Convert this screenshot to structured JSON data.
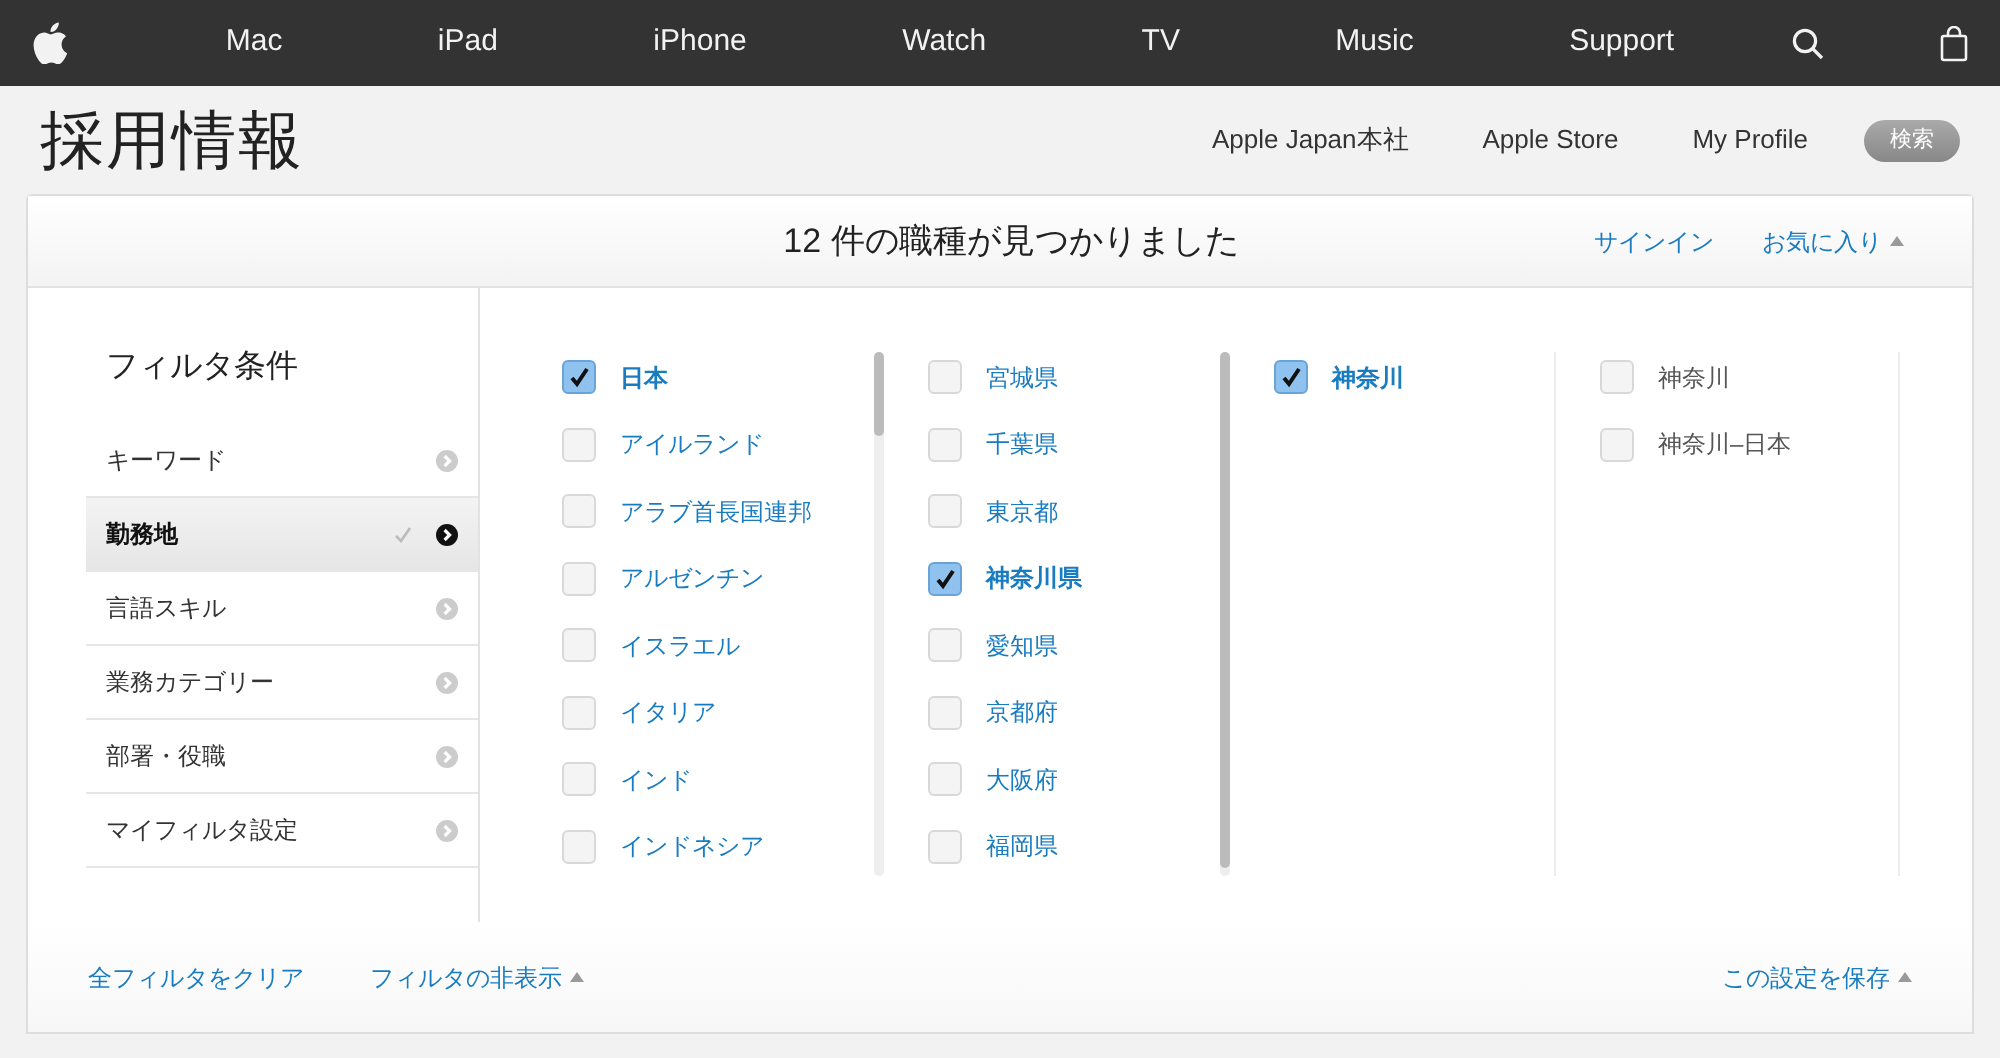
{
  "nav": {
    "items": [
      "Mac",
      "iPad",
      "iPhone",
      "Watch",
      "TV",
      "Music",
      "Support"
    ]
  },
  "header": {
    "title": "採用情報",
    "links": [
      "Apple Japan本社",
      "Apple Store",
      "My Profile"
    ],
    "search_button": "検索"
  },
  "results": {
    "title": "12 件の職種が見つかりました",
    "sign_in": "サインイン",
    "favorites": "お気に入り"
  },
  "filters": {
    "title": "フィルタ条件",
    "items": [
      {
        "label": "キーワード",
        "selected": false,
        "checked": false
      },
      {
        "label": "勤務地",
        "selected": true,
        "checked": true
      },
      {
        "label": "言語スキル",
        "selected": false,
        "checked": false
      },
      {
        "label": "業務カテゴリー",
        "selected": false,
        "checked": false
      },
      {
        "label": "部署・役職",
        "selected": false,
        "checked": false
      },
      {
        "label": "マイフィルタ設定",
        "selected": false,
        "checked": false
      }
    ]
  },
  "columns": [
    {
      "links": true,
      "scrollbar": true,
      "options": [
        {
          "label": "日本",
          "checked": true
        },
        {
          "label": "アイルランド",
          "checked": false
        },
        {
          "label": "アラブ首長国連邦",
          "checked": false
        },
        {
          "label": "アルゼンチン",
          "checked": false
        },
        {
          "label": "イスラエル",
          "checked": false
        },
        {
          "label": "イタリア",
          "checked": false
        },
        {
          "label": "インド",
          "checked": false
        },
        {
          "label": "インドネシア",
          "checked": false
        }
      ]
    },
    {
      "links": true,
      "scrollbar": true,
      "options": [
        {
          "label": "宮城県",
          "checked": false
        },
        {
          "label": "千葉県",
          "checked": false
        },
        {
          "label": "東京都",
          "checked": false
        },
        {
          "label": "神奈川県",
          "checked": true
        },
        {
          "label": "愛知県",
          "checked": false
        },
        {
          "label": "京都府",
          "checked": false
        },
        {
          "label": "大阪府",
          "checked": false
        },
        {
          "label": "福岡県",
          "checked": false
        }
      ]
    },
    {
      "links": true,
      "scrollbar": false,
      "options": [
        {
          "label": "神奈川",
          "checked": true
        }
      ]
    },
    {
      "links": false,
      "scrollbar": false,
      "options": [
        {
          "label": "神奈川",
          "checked": false
        },
        {
          "label": "神奈川–日本",
          "checked": false
        }
      ]
    }
  ],
  "footer": {
    "clear": "全フィルタをクリア",
    "hide": "フィルタの非表示",
    "save": "この設定を保存"
  }
}
